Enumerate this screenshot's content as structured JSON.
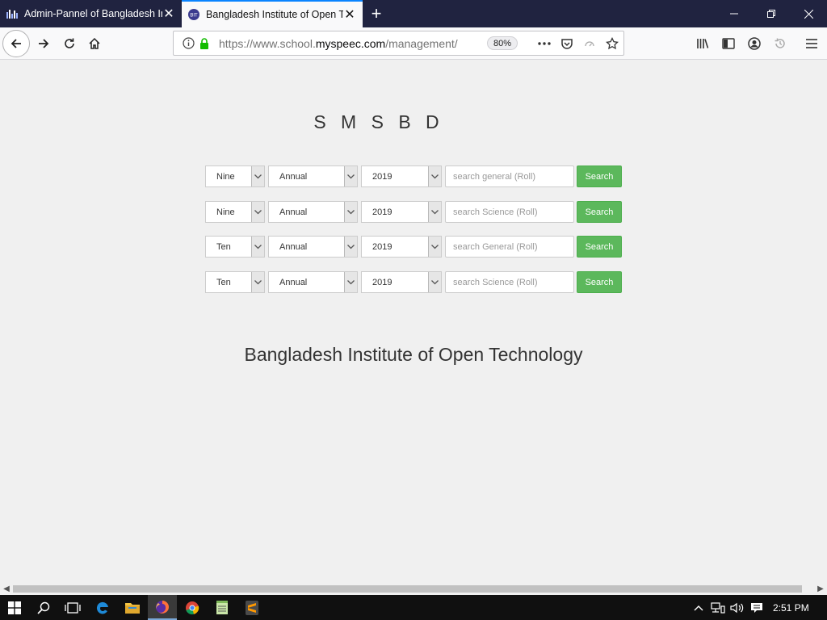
{
  "browser": {
    "tabs": [
      {
        "title": "Admin-Pannel of Bangladesh In",
        "active": false
      },
      {
        "title": "Bangladesh Institute of Open Te",
        "active": true
      }
    ],
    "url": {
      "prefix": "https://www.school.",
      "host": "myspeec.com",
      "path": "/management/r"
    },
    "zoom": "80%"
  },
  "page": {
    "brand": "S M S B D",
    "rows": [
      {
        "class_value": "Nine",
        "exam_value": "Annual",
        "year_value": "2019",
        "placeholder": "search general (Roll)",
        "button": "Search"
      },
      {
        "class_value": "Nine",
        "exam_value": "Annual",
        "year_value": "2019",
        "placeholder": "search Science (Roll)",
        "button": "Search"
      },
      {
        "class_value": "Ten",
        "exam_value": "Annual",
        "year_value": "2019",
        "placeholder": "search General (Roll)",
        "button": "Search"
      },
      {
        "class_value": "Ten",
        "exam_value": "Annual",
        "year_value": "2019",
        "placeholder": "search Science (Roll)",
        "button": "Search"
      }
    ],
    "org_name": "Bangladesh Institute of Open Technology"
  },
  "taskbar": {
    "clock": "2:51 PM",
    "icons": [
      "start-icon",
      "search-icon",
      "task-view-icon",
      "edge-icon",
      "file-explorer-icon",
      "firefox-icon",
      "chrome-icon",
      "notepad-icon",
      "sublime-text-icon"
    ]
  },
  "colors": {
    "titlebar": "#202340",
    "search_button": "#5cb85c",
    "background": "#f0f0f0",
    "active_tab_accent": "#0a84ff"
  }
}
